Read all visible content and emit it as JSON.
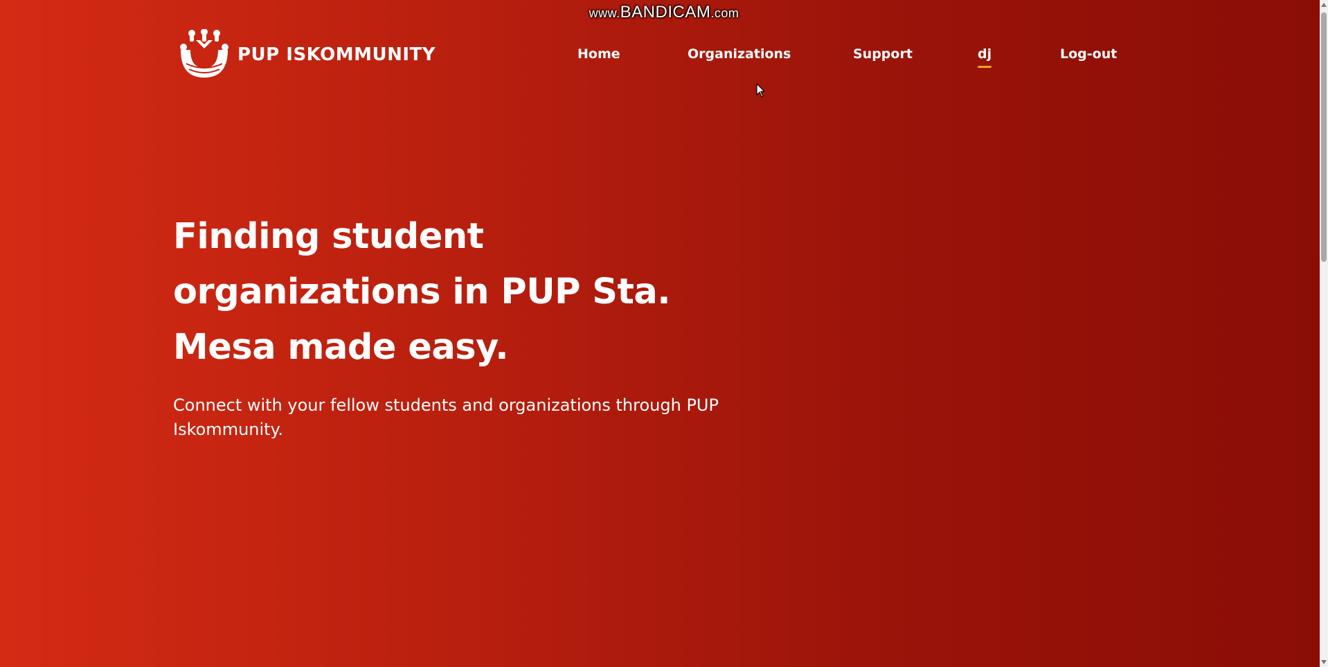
{
  "watermark": {
    "prefix": "www.",
    "brand": "BANDICAM",
    "suffix": ".com"
  },
  "header": {
    "logo_text": "PUP ISKOMMUNITY",
    "logo_icon": "iskommunity-logo-icon"
  },
  "nav": {
    "items": [
      {
        "label": "Home"
      },
      {
        "label": "Organizations"
      },
      {
        "label": "Support"
      },
      {
        "label": "dj"
      },
      {
        "label": "Log-out"
      }
    ],
    "active_index": 3,
    "active_underline_color": "#f5a623"
  },
  "hero": {
    "title_lines": [
      "Finding student",
      "organizations in PUP Sta.",
      "Mesa made easy."
    ],
    "subtitle": "Connect with your fellow students and organizations through PUP Iskommunity."
  },
  "colors": {
    "background_start": "#d42b14",
    "background_end": "#8a0d06",
    "text": "#ffffff"
  }
}
